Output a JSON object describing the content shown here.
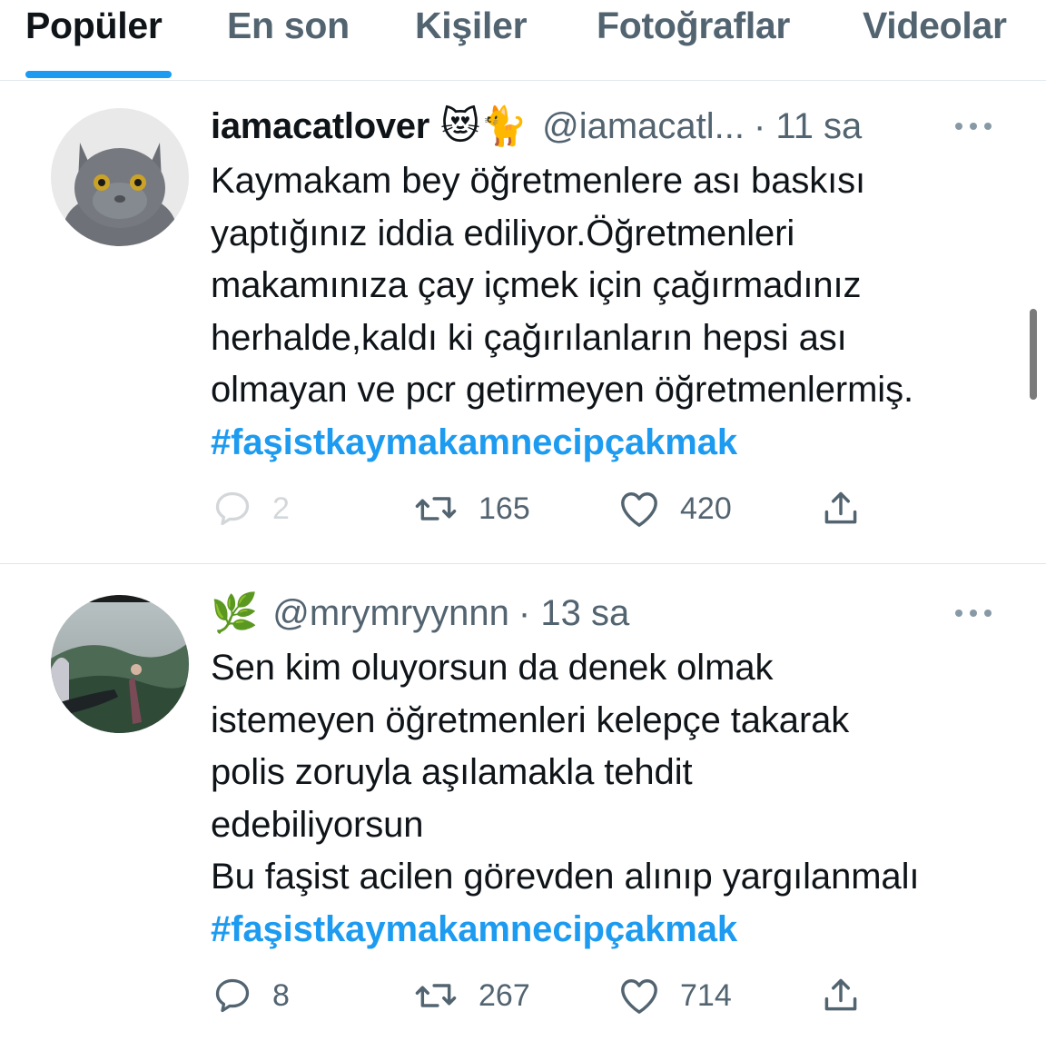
{
  "tabs": [
    {
      "label": "Popüler"
    },
    {
      "label": "En son"
    },
    {
      "label": "Kişiler"
    },
    {
      "label": "Fotoğraflar"
    },
    {
      "label": "Videolar"
    }
  ],
  "tweets": [
    {
      "display_name": "iamacatlover",
      "emojis": "😻🐈",
      "handle": "@iamacatl...",
      "time": "· 11 sa",
      "text_lines": [
        "Kaymakam bey öğretmenlere ası baskısı",
        "yaptığınız iddia ediliyor.Öğretmenleri",
        "makamınıza çay içmek için çağırmadınız",
        "herhalde,kaldı ki çağırılanların hepsi ası",
        "olmayan ve pcr getirmeyen öğretmenlermiş."
      ],
      "hashtag": "#faşistkaymakamnecipçakmak",
      "replies": "2",
      "retweets": "165",
      "likes": "420"
    },
    {
      "display_name": "",
      "emojis": "🌿",
      "handle": "@mrymryynnn",
      "time": "· 13 sa",
      "text_lines": [
        "Sen kim oluyorsun da denek olmak",
        "istemeyen öğretmenleri kelepçe takarak",
        "polis zoruyla aşılamakla tehdit",
        "edebiliyorsun",
        "Bu faşist acilen görevden alınıp yargılanmalı"
      ],
      "hashtag": "#faşistkaymakamnecipçakmak",
      "replies": "8",
      "retweets": "267",
      "likes": "714"
    }
  ],
  "colors": {
    "accent": "#1d9bf0",
    "secondary_text": "#536471",
    "primary_text": "#0f1419"
  },
  "icons": [
    "reply-icon",
    "retweet-icon",
    "like-icon",
    "share-icon",
    "more-icon"
  ]
}
